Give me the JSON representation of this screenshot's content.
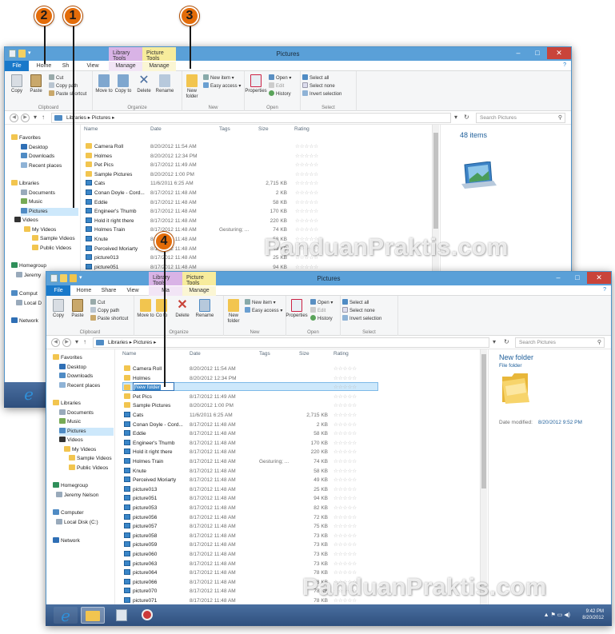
{
  "callouts": [
    "2",
    "1",
    "3",
    "4"
  ],
  "watermark": "PanduanPraktis.com",
  "window_title": "Pictures",
  "context_tabs": {
    "library": "Library Tools",
    "picture": "Picture Tools"
  },
  "tabs": {
    "file": "File",
    "home": "Home",
    "share": "Share",
    "view": "View",
    "manage": "Manage",
    "manage_cut": "Ma",
    "share_cut": "Sh"
  },
  "help": "?",
  "ribbon": {
    "copy": "Copy",
    "paste": "Paste",
    "cut": "Cut",
    "copy_path": "Copy path",
    "copy_path_cut": "Copy path",
    "paste_shortcut": "Paste shortcut",
    "move_to": "Move to",
    "copy_to": "Copy to",
    "copy_to_cut": "Co to",
    "delete": "Delete",
    "rename": "Rename",
    "new_folder": "New folder",
    "new_item": "New item",
    "easy_access": "Easy access",
    "properties": "Properties",
    "open": "Open",
    "edit": "Edit",
    "history": "History",
    "select_all": "Select all",
    "select_none": "Select none",
    "invert_selection": "Invert selection",
    "groups": {
      "clipboard": "Clipboard",
      "organize": "Organize",
      "new": "New",
      "open": "Open",
      "select": "Select"
    }
  },
  "address": {
    "path": "Libraries  ▸  Pictures  ▸",
    "search_placeholder": "Search Pictures"
  },
  "columns": {
    "name": "Name",
    "date": "Date",
    "tags": "Tags",
    "size": "Size",
    "rating": "Rating"
  },
  "nav_back": [
    "Favorites",
    "Desktop",
    "Downloads",
    "Recent places",
    "Libraries",
    "Documents",
    "Music",
    "Pictures",
    "Videos",
    "My Videos",
    "Sample Videos",
    "Public Videos",
    "Homegroup",
    "Jeremy",
    "Comput",
    "Local D",
    "Network"
  ],
  "nav_front": [
    "Favorites",
    "Desktop",
    "Downloads",
    "Recent places",
    "Libraries",
    "Documents",
    "Music",
    "Pictures",
    "Videos",
    "My Videos",
    "Sample Videos",
    "Public Videos",
    "Homegroup",
    "Jeremy Nelson",
    "Computer",
    "Local Disk (C:)",
    "Network"
  ],
  "files_back": [
    {
      "name": "Camera Roll",
      "date": "8/20/2012 11:54 AM",
      "tags": "",
      "size": "",
      "icon": "folder-icon"
    },
    {
      "name": "Holmes",
      "date": "8/20/2012 12:34 PM",
      "tags": "",
      "size": "",
      "icon": "folder-icon"
    },
    {
      "name": "Pet Pics",
      "date": "8/17/2012 11:49 AM",
      "tags": "",
      "size": "",
      "icon": "folder-icon"
    },
    {
      "name": "Sample Pictures",
      "date": "8/20/2012 1:00 PM",
      "tags": "",
      "size": "",
      "icon": "folder-icon"
    },
    {
      "name": "Cats",
      "date": "11/6/2011 6:25 AM",
      "tags": "",
      "size": "2,715 KB",
      "icon": "image-icon"
    },
    {
      "name": "Conan Doyle - Cord...",
      "date": "8/17/2012 11:48 AM",
      "tags": "",
      "size": "2 KB",
      "icon": "image-icon"
    },
    {
      "name": "Eddie",
      "date": "8/17/2012 11:48 AM",
      "tags": "",
      "size": "58 KB",
      "icon": "image-icon"
    },
    {
      "name": "Engineer's Thumb",
      "date": "8/17/2012 11:48 AM",
      "tags": "",
      "size": "170 KB",
      "icon": "image-icon"
    },
    {
      "name": "Hold it right there",
      "date": "8/17/2012 11:48 AM",
      "tags": "",
      "size": "220 KB",
      "icon": "image-icon"
    },
    {
      "name": "Holmes Train",
      "date": "8/17/2012 11:48 AM",
      "tags": "Gesturing; ...",
      "size": "74 KB",
      "icon": "image-icon"
    },
    {
      "name": "Knute",
      "date": "8/17/2012 11:48 AM",
      "tags": "",
      "size": "58 KB",
      "icon": "image-icon"
    },
    {
      "name": "Perceived Moriarty",
      "date": "8/17/2012 11:48 AM",
      "tags": "",
      "size": "49 KB",
      "icon": "image-icon"
    },
    {
      "name": "picture013",
      "date": "8/17/2012 11:48 AM",
      "tags": "",
      "size": "25 KB",
      "icon": "image-icon"
    },
    {
      "name": "picture051",
      "date": "8/17/2012 11:48 AM",
      "tags": "",
      "size": "94 KB",
      "icon": "image-icon"
    }
  ],
  "files_front": [
    {
      "name": "Camera Roll",
      "date": "8/20/2012 11:54 AM",
      "tags": "",
      "size": "",
      "icon": "folder-icon"
    },
    {
      "name": "Holmes",
      "date": "8/20/2012 12:34 PM",
      "tags": "",
      "size": "",
      "icon": "folder-icon"
    },
    {
      "name": "New folder",
      "date": "",
      "tags": "",
      "size": "",
      "icon": "folder-icon",
      "editing": true
    },
    {
      "name": "Pet Pics",
      "date": "8/17/2012 11:49 AM",
      "tags": "",
      "size": "",
      "icon": "folder-icon"
    },
    {
      "name": "Sample Pictures",
      "date": "8/20/2012 1:00 PM",
      "tags": "",
      "size": "",
      "icon": "folder-icon"
    },
    {
      "name": "Cats",
      "date": "11/6/2011 6:25 AM",
      "tags": "",
      "size": "2,715 KB",
      "icon": "image-icon"
    },
    {
      "name": "Conan Doyle - Cord...",
      "date": "8/17/2012 11:48 AM",
      "tags": "",
      "size": "2 KB",
      "icon": "image-icon"
    },
    {
      "name": "Eddie",
      "date": "8/17/2012 11:48 AM",
      "tags": "",
      "size": "58 KB",
      "icon": "image-icon"
    },
    {
      "name": "Engineer's Thumb",
      "date": "8/17/2012 11:48 AM",
      "tags": "",
      "size": "170 KB",
      "icon": "image-icon"
    },
    {
      "name": "Hold it right there",
      "date": "8/17/2012 11:48 AM",
      "tags": "",
      "size": "220 KB",
      "icon": "image-icon"
    },
    {
      "name": "Holmes Train",
      "date": "8/17/2012 11:48 AM",
      "tags": "Gesturing; ...",
      "size": "74 KB",
      "icon": "image-icon"
    },
    {
      "name": "Knute",
      "date": "8/17/2012 11:48 AM",
      "tags": "",
      "size": "58 KB",
      "icon": "image-icon"
    },
    {
      "name": "Perceived Moriarty",
      "date": "8/17/2012 11:48 AM",
      "tags": "",
      "size": "49 KB",
      "icon": "image-icon"
    },
    {
      "name": "picture013",
      "date": "8/17/2012 11:48 AM",
      "tags": "",
      "size": "25 KB",
      "icon": "image-icon"
    },
    {
      "name": "picture051",
      "date": "8/17/2012 11:48 AM",
      "tags": "",
      "size": "94 KB",
      "icon": "image-icon"
    },
    {
      "name": "picture053",
      "date": "8/17/2012 11:48 AM",
      "tags": "",
      "size": "82 KB",
      "icon": "image-icon"
    },
    {
      "name": "picture056",
      "date": "8/17/2012 11:48 AM",
      "tags": "",
      "size": "72 KB",
      "icon": "image-icon"
    },
    {
      "name": "picture057",
      "date": "8/17/2012 11:48 AM",
      "tags": "",
      "size": "75 KB",
      "icon": "image-icon"
    },
    {
      "name": "picture058",
      "date": "8/17/2012 11:48 AM",
      "tags": "",
      "size": "73 KB",
      "icon": "image-icon"
    },
    {
      "name": "picture059",
      "date": "8/17/2012 11:48 AM",
      "tags": "",
      "size": "73 KB",
      "icon": "image-icon"
    },
    {
      "name": "picture060",
      "date": "8/17/2012 11:48 AM",
      "tags": "",
      "size": "73 KB",
      "icon": "image-icon"
    },
    {
      "name": "picture063",
      "date": "8/17/2012 11:48 AM",
      "tags": "",
      "size": "73 KB",
      "icon": "image-icon"
    },
    {
      "name": "picture064",
      "date": "8/17/2012 11:48 AM",
      "tags": "",
      "size": "78 KB",
      "icon": "image-icon"
    },
    {
      "name": "picture066",
      "date": "8/17/2012 11:48 AM",
      "tags": "",
      "size": "78 KB",
      "icon": "image-icon"
    },
    {
      "name": "picture070",
      "date": "8/17/2012 11:48 AM",
      "tags": "",
      "size": "78 KB",
      "icon": "image-icon"
    },
    {
      "name": "picture071",
      "date": "8/17/2012 11:48 AM",
      "tags": "",
      "size": "78 KB",
      "icon": "image-icon"
    }
  ],
  "rating_stars": "☆☆☆☆☆",
  "preview_back": {
    "count": "48 items"
  },
  "preview_front": {
    "name": "New folder",
    "type": "File folder",
    "date_label": "Date modified:",
    "date_value": "8/20/2012 9:52 PM"
  },
  "taskbar": {
    "time": "9:42 PM",
    "date": "8/20/2012",
    "tray_icons": "▲ ⚑ ▭ ◀)"
  },
  "colors": {
    "accent": "#1979ca",
    "titlebar": "#5aa0d8",
    "callout": "#e36c09",
    "close": "#c9443a",
    "library_tab": "#d9b3e6",
    "picture_tab": "#f7ec9c"
  }
}
